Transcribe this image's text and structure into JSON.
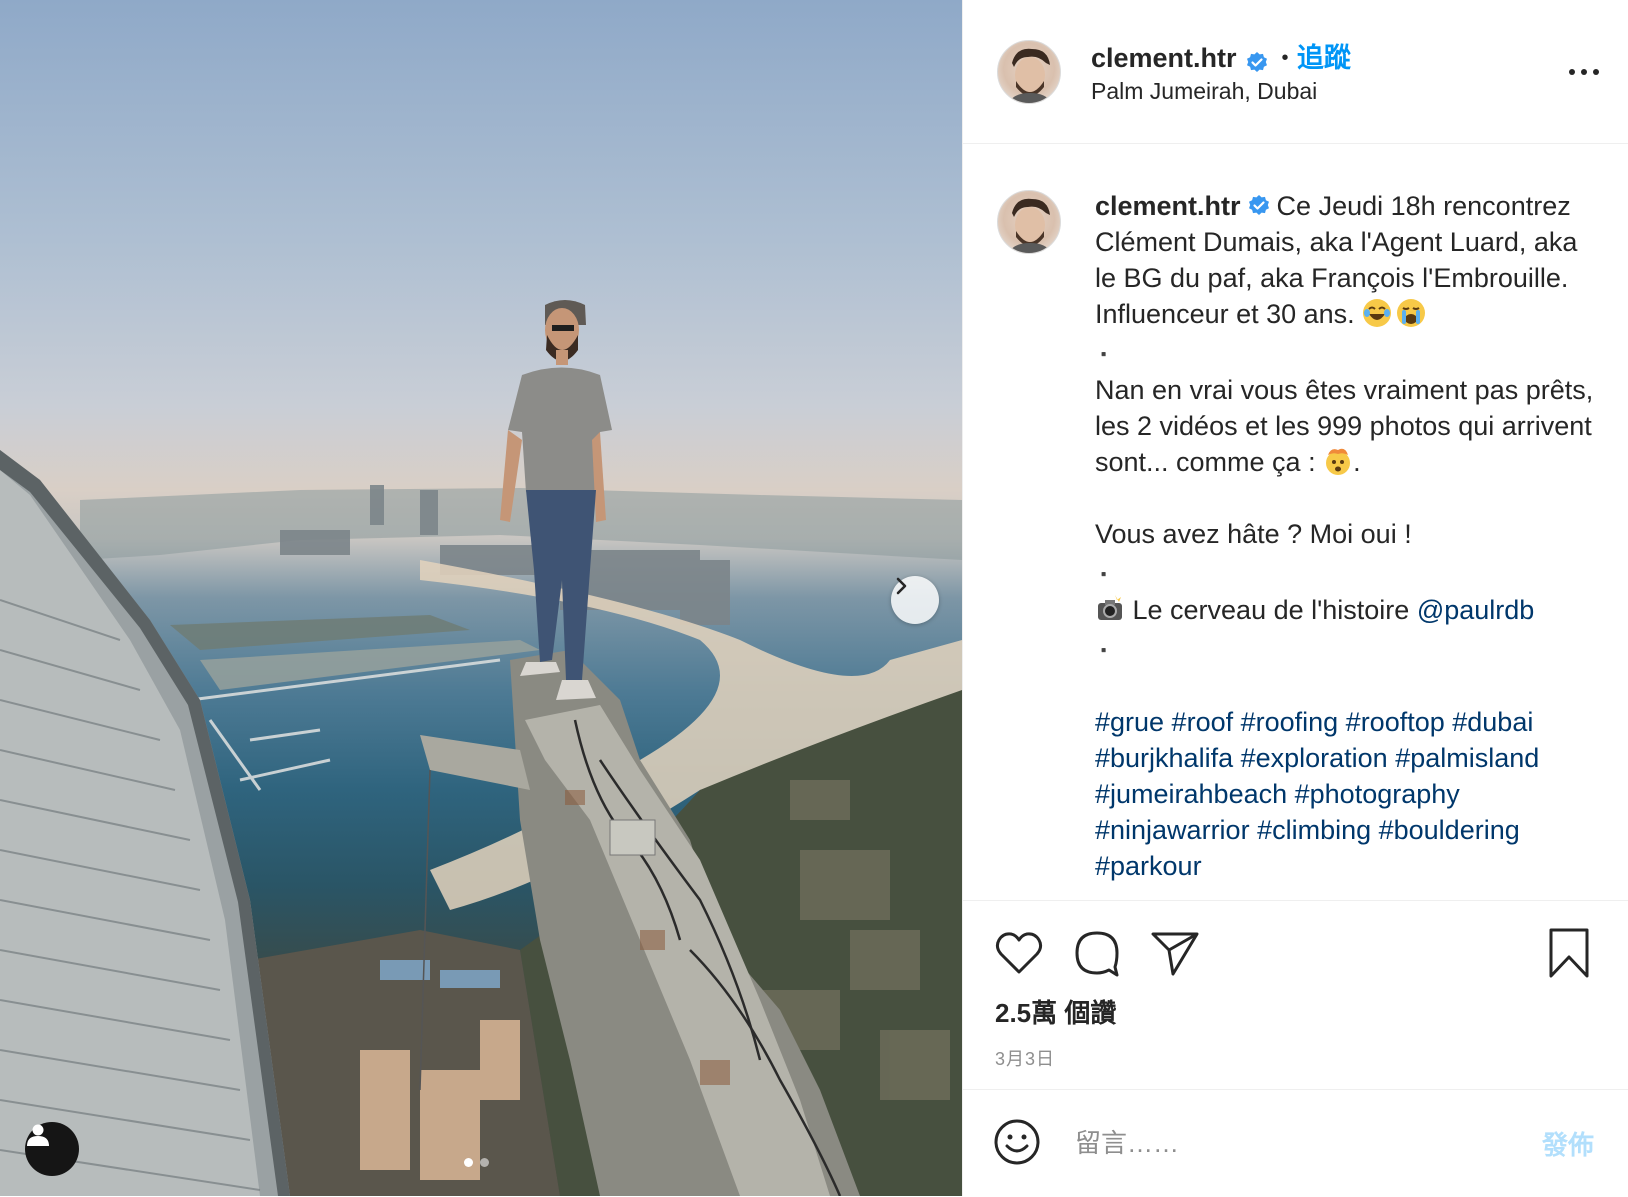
{
  "post": {
    "username": "clement.htr",
    "follow_label": "追蹤",
    "separator": "•",
    "location": "Palm Jumeirah, Dubai",
    "caption": {
      "username": "clement.htr",
      "text": "Ce Jeudi 18h rencontrez Clément Dumais, aka l'Agent Luard, aka le BG du paf, aka François l'Embrouille. Influenceur et 30 ans. ",
      "dot1": "▪️",
      "line2": "Nan en vrai vous êtes vraiment pas prêts, les 2 vidéos et les 999 photos qui arrivent sont... comme ça : ",
      "line2_end": ".",
      "line3": "Vous avez hâte ? Moi oui !",
      "dot2": "▪️",
      "line4": " Le cerveau de l'histoire ",
      "mention": "@paulrdb",
      "dot3": "▪️",
      "hashtags": "#grue #roof #roofing #rooftop #dubai #burjkhalifa #exploration #palmisland #jumeirahbeach #photography #ninjawarrior #climbing #bouldering #parkour"
    },
    "likes": "2.5萬 個讚",
    "date": "3月3日"
  },
  "comment": {
    "placeholder": "留言……",
    "post_label": "發佈"
  },
  "carousel": {
    "total": 2,
    "current": 1
  },
  "colors": {
    "accent": "#0095f6",
    "link": "#00376b",
    "verified": "#3897f0",
    "muted": "#8e8e8e"
  }
}
